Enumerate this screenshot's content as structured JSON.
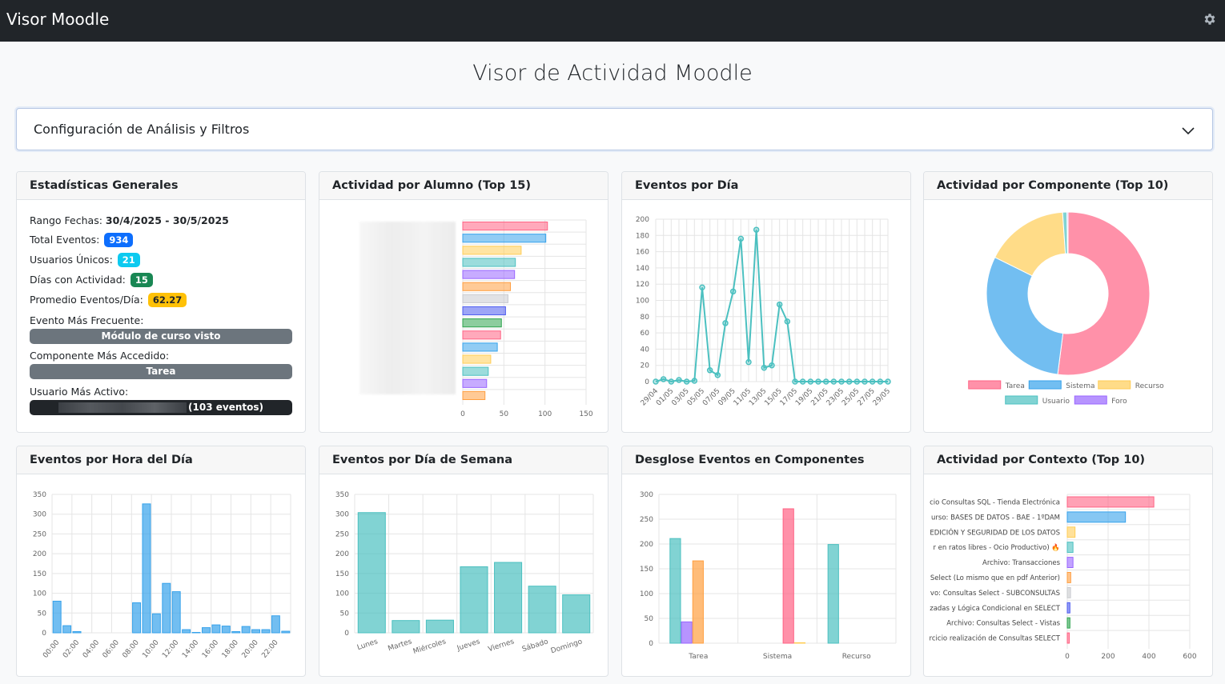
{
  "app": {
    "title": "Visor Moodle",
    "settings_icon": "gear-icon"
  },
  "page": {
    "title": "Visor de Actividad Moodle"
  },
  "filters": {
    "label": "Configuración de Análisis y Filtros",
    "icon": "chevron-down-icon"
  },
  "stats": {
    "title": "Estadísticas Generales",
    "range_label": "Rango Fechas:",
    "range_value": "30/4/2025 - 30/5/2025",
    "total_label": "Total Eventos:",
    "total_value": "934",
    "users_label": "Usuarios Únicos:",
    "users_value": "21",
    "days_label": "Días con Actividad:",
    "days_value": "15",
    "avg_label": "Promedio Eventos/Día:",
    "avg_value": "62.27",
    "freq_label": "Evento Más Frecuente:",
    "freq_value": "Módulo de curso visto",
    "comp_label": "Componente Más Accedido:",
    "comp_value": "Tarea",
    "active_label": "Usuario Más Activo:",
    "active_value": "(103 eventos)",
    "colors": {
      "blue": "#0d6efd",
      "cyan": "#0dcaf0",
      "green": "#198754",
      "yellow": "#ffc107",
      "gray": "#6c757d",
      "dark": "#212529"
    }
  },
  "cards": {
    "students": "Actividad por Alumno (Top 15)",
    "daily": "Eventos por Día",
    "components": "Actividad por Componente (Top 10)",
    "hourly": "Eventos por Hora del Día",
    "weekday": "Eventos por Día de Semana",
    "breakdown": "Desglose Eventos en Componentes",
    "context": "Actividad por Contexto (Top 10)"
  },
  "chart_data": [
    {
      "id": "students",
      "type": "bar",
      "orientation": "horizontal",
      "categories_redacted": true,
      "values": [
        103,
        101,
        71,
        64,
        63,
        58,
        55,
        52,
        47,
        46,
        42,
        34,
        31,
        29,
        27
      ],
      "colors": [
        "#ff6384",
        "#36a2eb",
        "#ffcd56",
        "#4bc0c0",
        "#9966ff",
        "#ff9f40",
        "#c9cbcf",
        "#4d5bef",
        "#2ea44f",
        "#ff6384",
        "#36a2eb",
        "#ffcd56",
        "#4bc0c0",
        "#9966ff",
        "#ff9f40"
      ],
      "xlim": [
        0,
        150
      ],
      "xticks": [
        "0",
        "50",
        "100",
        "150"
      ]
    },
    {
      "id": "daily",
      "type": "line",
      "color": "#4bc0c0",
      "x": [
        "29/04",
        "30/04",
        "01/05",
        "02/05",
        "03/05",
        "04/05",
        "05/05",
        "06/05",
        "07/05",
        "08/05",
        "09/05",
        "10/05",
        "11/05",
        "12/05",
        "13/05",
        "14/05",
        "15/05",
        "16/05",
        "17/05",
        "18/05",
        "19/05",
        "20/05",
        "21/05",
        "22/05",
        "23/05",
        "24/05",
        "25/05",
        "26/05",
        "27/05",
        "28/05",
        "29/05"
      ],
      "x_tick_labels": [
        "29/04",
        "01/05",
        "03/05",
        "05/05",
        "07/05",
        "09/05",
        "11/05",
        "13/05",
        "15/05",
        "17/05",
        "19/05",
        "21/05",
        "23/05",
        "25/05",
        "27/05",
        "29/05"
      ],
      "values": [
        0,
        3,
        0,
        2,
        0,
        1,
        116,
        14,
        8,
        72,
        111,
        176,
        24,
        187,
        17,
        20,
        95,
        74,
        0,
        0,
        0,
        0,
        0,
        0,
        0,
        0,
        0,
        0,
        0,
        0,
        0
      ],
      "ylim": [
        0,
        200
      ],
      "yticks": [
        "0",
        "20",
        "40",
        "60",
        "80",
        "100",
        "120",
        "140",
        "160",
        "180",
        "200"
      ]
    },
    {
      "id": "components",
      "type": "pie",
      "donut": true,
      "labels": [
        "Tarea",
        "Sistema",
        "Recurso",
        "Usuario",
        "Foro"
      ],
      "values": [
        486,
        283,
        155,
        8,
        2
      ],
      "colors": [
        "#ff6384",
        "#36a2eb",
        "#ffcd56",
        "#4bc0c0",
        "#9966ff"
      ],
      "legend": "bottom"
    },
    {
      "id": "hourly",
      "type": "bar",
      "color": "#36a2eb",
      "categories": [
        "00:00",
        "01:00",
        "02:00",
        "03:00",
        "04:00",
        "05:00",
        "06:00",
        "07:00",
        "08:00",
        "09:00",
        "10:00",
        "11:00",
        "12:00",
        "13:00",
        "14:00",
        "15:00",
        "16:00",
        "17:00",
        "18:00",
        "19:00",
        "20:00",
        "21:00",
        "22:00",
        "23:00"
      ],
      "x_tick_labels": [
        "00:00",
        "02:00",
        "04:00",
        "06:00",
        "08:00",
        "10:00",
        "12:00",
        "14:00",
        "16:00",
        "18:00",
        "20:00",
        "22:00"
      ],
      "values": [
        80,
        18,
        3,
        0,
        0,
        0,
        0,
        0,
        76,
        326,
        48,
        125,
        104,
        8,
        1,
        13,
        20,
        17,
        3,
        16,
        8,
        8,
        43,
        4
      ],
      "ylim": [
        0,
        350
      ],
      "yticks": [
        "0",
        "50",
        "100",
        "150",
        "200",
        "250",
        "300",
        "350"
      ]
    },
    {
      "id": "weekday",
      "type": "bar",
      "color": "#4bc0c0",
      "categories": [
        "Lunes",
        "Martes",
        "Miércoles",
        "Jueves",
        "Viernes",
        "Sábado",
        "Domingo"
      ],
      "values": [
        304,
        31,
        32,
        167,
        178,
        118,
        96
      ],
      "ylim": [
        0,
        350
      ],
      "yticks": [
        "0",
        "50",
        "100",
        "150",
        "200",
        "250",
        "300",
        "350"
      ]
    },
    {
      "id": "breakdown",
      "type": "bar",
      "categories": [
        "Tarea",
        "Sistema",
        "Recurso"
      ],
      "series": [
        {
          "color": "#4bc0c0",
          "values": [
            211,
            0,
            199
          ]
        },
        {
          "color": "#9966ff",
          "values": [
            43,
            0,
            0
          ]
        },
        {
          "color": "#ff9f40",
          "values": [
            166,
            0,
            0
          ]
        },
        {
          "color": "#ff6384",
          "values": [
            0,
            271,
            0
          ]
        },
        {
          "color": "#ffcd56",
          "values": [
            0,
            1,
            0
          ]
        }
      ],
      "ylim": [
        0,
        300
      ],
      "yticks": [
        "0",
        "50",
        "100",
        "150",
        "200",
        "250",
        "300"
      ]
    },
    {
      "id": "context",
      "type": "bar",
      "orientation": "horizontal",
      "categories": [
        "cio Consultas SQL - Tienda Electrónica",
        "urso: BASES DE DATOS - BAE - 1ºDAM",
        "EDICIÓN Y SEGURIDAD DE LOS DATOS",
        "r en ratos libres - Ocio Productivo) 🔥",
        "Archivo: Transacciones",
        "Select (Lo mismo que en pdf Anterior)",
        "vo: Consultas Select - SUBCONSULTAS",
        "zadas y Lógica Condicional en SELECT",
        "Archivo: Consultas Select - Vistas",
        "rcicio realización de Consultas SELECT"
      ],
      "values": [
        424,
        285,
        38,
        28,
        28,
        17,
        16,
        13,
        13,
        10
      ],
      "colors": [
        "#ff6384",
        "#36a2eb",
        "#ffcd56",
        "#4bc0c0",
        "#9966ff",
        "#ff9f40",
        "#c9cbcf",
        "#4d5bef",
        "#2ea44f",
        "#ff6384"
      ],
      "xlim": [
        0,
        600
      ],
      "xticks": [
        "0",
        "200",
        "400",
        "600"
      ]
    }
  ]
}
